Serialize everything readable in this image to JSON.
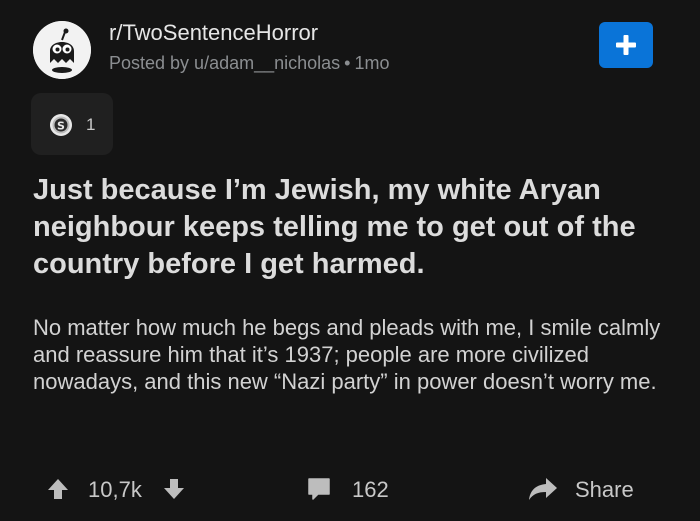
{
  "post": {
    "subreddit": "r/TwoSentenceHorror",
    "posted_by": "Posted by u/adam__nicholas",
    "meta_separator": "•",
    "age": "1mo",
    "join_icon": "plus-icon",
    "award_count": "1",
    "title": "Just because I’m Jewish, my white Aryan neighbour keeps telling me to get out of the country before I get harmed.",
    "body": "No matter how much he begs and pleads with me, I smile calmly and reassure him that it’s 1937; people are more civilized nowadays, and this new “Nazi party” in power doesn’t worry me."
  },
  "actions": {
    "score": "10,7k",
    "comments": "162",
    "share_label": "Share"
  },
  "colors": {
    "background": "#141414",
    "accent": "#0a74d8",
    "text_primary": "#dcdcdc",
    "text_secondary": "#8b8e91",
    "icon": "#bdbdbd"
  }
}
